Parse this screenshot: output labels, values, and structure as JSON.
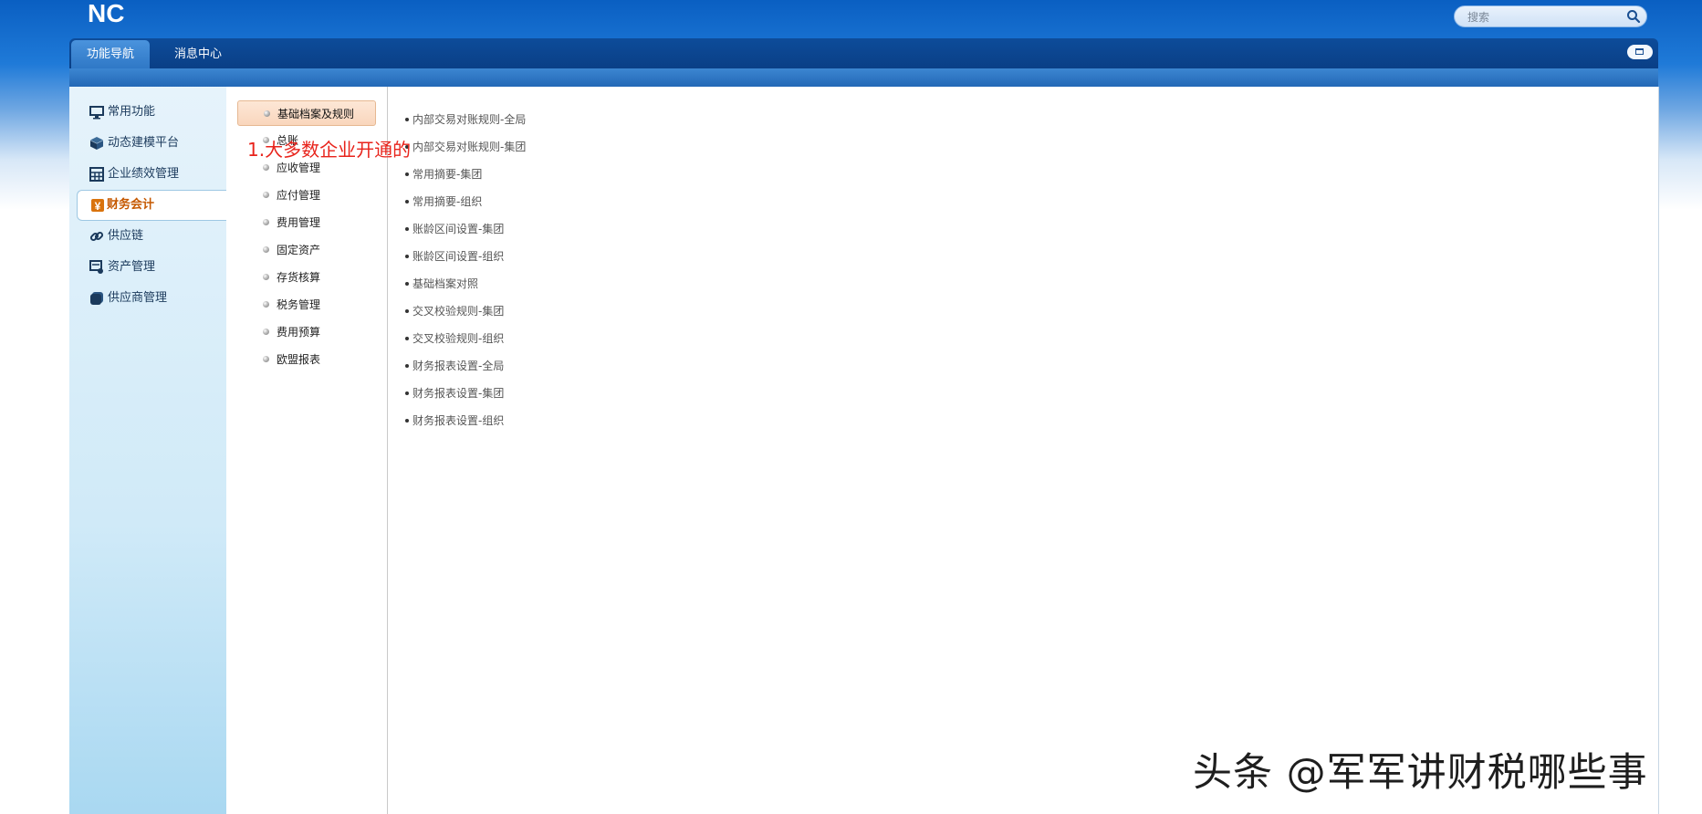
{
  "header": {
    "logo_text": "NC",
    "search": {
      "placeholder": "搜索"
    }
  },
  "nav": {
    "tabs": [
      {
        "label": "功能导航",
        "active": true
      },
      {
        "label": "消息中心",
        "active": false
      }
    ]
  },
  "sidebar": {
    "items": [
      {
        "label": "常用功能",
        "icon": "monitor-icon"
      },
      {
        "label": "动态建模平台",
        "icon": "cube-icon"
      },
      {
        "label": "企业绩效管理",
        "icon": "table-icon"
      },
      {
        "label": "财务会计",
        "icon": "yen-icon",
        "active": true
      },
      {
        "label": "供应链",
        "icon": "link-icon"
      },
      {
        "label": "资产管理",
        "icon": "asset-icon"
      },
      {
        "label": "供应商管理",
        "icon": "supplier-icon"
      }
    ]
  },
  "middle": {
    "items": [
      {
        "label": "基础档案及规则",
        "active": true
      },
      {
        "label": "总账"
      },
      {
        "label": "应收管理"
      },
      {
        "label": "应付管理"
      },
      {
        "label": "费用管理"
      },
      {
        "label": "固定资产"
      },
      {
        "label": "存货核算"
      },
      {
        "label": "税务管理"
      },
      {
        "label": "费用预算"
      },
      {
        "label": "欧盟报表"
      }
    ]
  },
  "content": {
    "links": [
      "内部交易对账规则-全局",
      "内部交易对账规则-集团",
      "常用摘要-集团",
      "常用摘要-组织",
      "账龄区间设置-集团",
      "账龄区间设置-组织",
      "基础档案对照",
      "交叉校验规则-集团",
      "交叉校验规则-组织",
      "财务报表设置-全局",
      "财务报表设置-集团",
      "财务报表设置-组织"
    ]
  },
  "annotation": "1.大多数企业开通的",
  "watermark": "头条 @军军讲财税哪些事",
  "colors": {
    "header_blue": "#0a5fc2",
    "nav_dark": "#0d4c9a",
    "active_sidebar_text": "#c55800",
    "annotation_red": "#e8231b"
  }
}
